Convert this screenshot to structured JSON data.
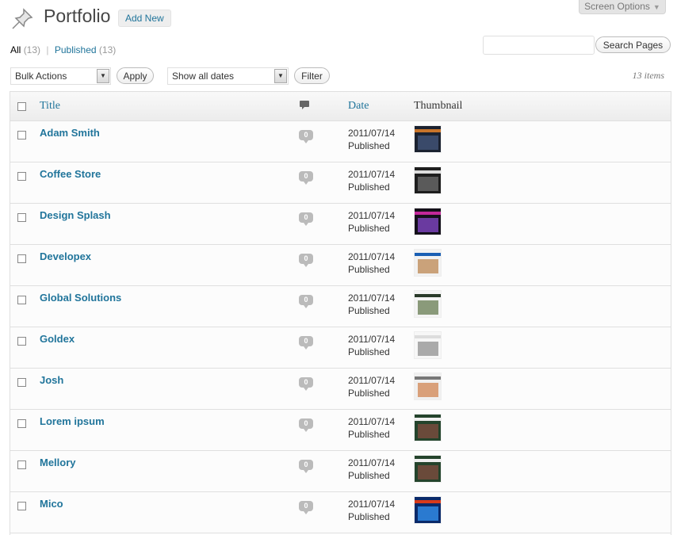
{
  "header": {
    "screen_options": "Screen Options",
    "title": "Portfolio",
    "add_new": "Add New"
  },
  "filters": {
    "all_label": "All",
    "all_count": "(13)",
    "separator": "|",
    "published_label": "Published",
    "published_count": "(13)"
  },
  "search": {
    "placeholder": "",
    "button": "Search Pages"
  },
  "tablenav": {
    "bulk_actions": "Bulk Actions",
    "apply": "Apply",
    "dates": "Show all dates",
    "filter": "Filter",
    "items_count": "13 items"
  },
  "table": {
    "columns": {
      "title": "Title",
      "comments_icon": "comment-icon",
      "date": "Date",
      "thumbnail": "Thumbnail"
    },
    "rows": [
      {
        "title": "Adam Smith",
        "comments": "0",
        "date": "2011/07/14",
        "status": "Published",
        "thumb": [
          "#1b2230",
          "#c8742a",
          "#3a4a6a"
        ]
      },
      {
        "title": "Coffee Store",
        "comments": "0",
        "date": "2011/07/14",
        "status": "Published",
        "thumb": [
          "#1e1e1e",
          "#dcdcdc",
          "#5a5a5a"
        ]
      },
      {
        "title": "Design Splash",
        "comments": "0",
        "date": "2011/07/14",
        "status": "Published",
        "thumb": [
          "#14101a",
          "#c2289a",
          "#6a3aa0"
        ]
      },
      {
        "title": "Developex",
        "comments": "0",
        "date": "2011/07/14",
        "status": "Published",
        "thumb": [
          "#f2f2f2",
          "#1a5fb4",
          "#caa27a"
        ]
      },
      {
        "title": "Global Solutions",
        "comments": "0",
        "date": "2011/07/14",
        "status": "Published",
        "thumb": [
          "#f4f4f4",
          "#2a3a2a",
          "#8a9a7a"
        ]
      },
      {
        "title": "Goldex",
        "comments": "0",
        "date": "2011/07/14",
        "status": "Published",
        "thumb": [
          "#f7f7f7",
          "#dddddd",
          "#aaaaaa"
        ]
      },
      {
        "title": "Josh",
        "comments": "0",
        "date": "2011/07/14",
        "status": "Published",
        "thumb": [
          "#f0f0f0",
          "#777777",
          "#d9a07a"
        ]
      },
      {
        "title": "Lorem ipsum",
        "comments": "0",
        "date": "2011/07/14",
        "status": "Published",
        "thumb": [
          "#24442c",
          "#f0f0f0",
          "#6a4a3a"
        ]
      },
      {
        "title": "Mellory",
        "comments": "0",
        "date": "2011/07/14",
        "status": "Published",
        "thumb": [
          "#24442c",
          "#f0f0f0",
          "#6a4a3a"
        ]
      },
      {
        "title": "Mico",
        "comments": "0",
        "date": "2011/07/14",
        "status": "Published",
        "thumb": [
          "#0a2a6a",
          "#d83a1a",
          "#2a7ad0"
        ]
      }
    ]
  }
}
